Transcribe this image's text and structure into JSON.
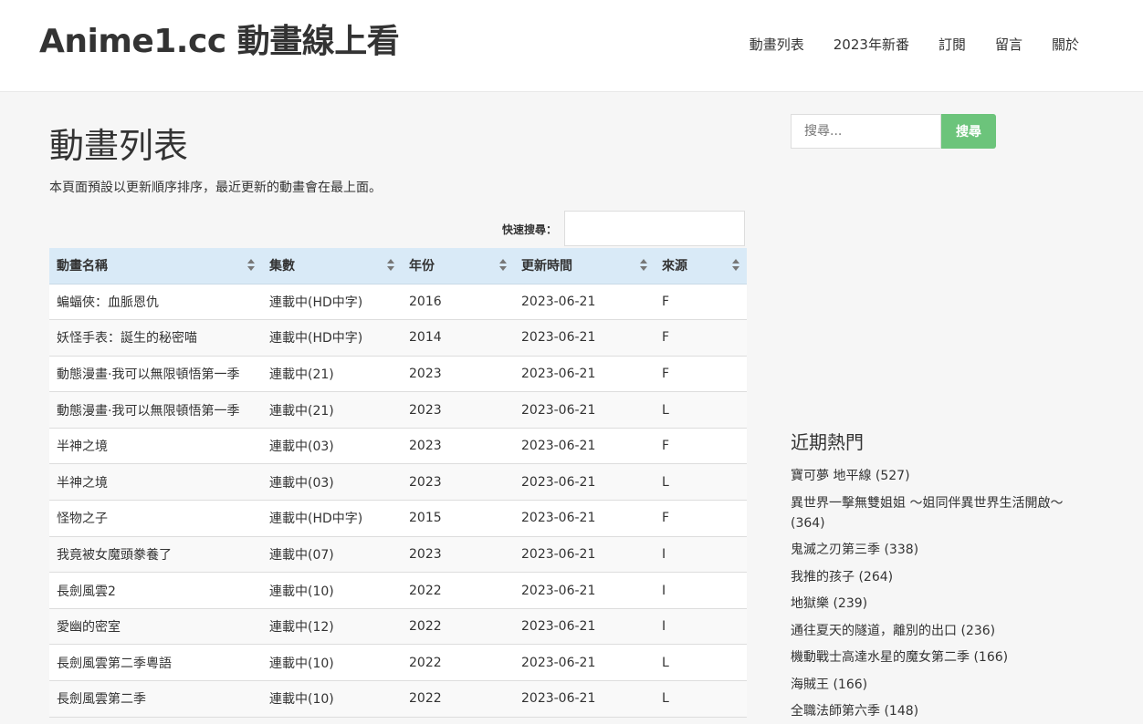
{
  "site": {
    "title": "Anime1.cc 動畫線上看"
  },
  "nav": [
    "動畫列表",
    "2023年新番",
    "訂閱",
    "留言",
    "關於"
  ],
  "page": {
    "title": "動畫列表",
    "intro": "本頁面預設以更新順序排序，最近更新的動畫會在最上面。",
    "quick_search_label": "快速搜尋："
  },
  "table": {
    "headers": [
      "動畫名稱",
      "集數",
      "年份",
      "更新時間",
      "來源"
    ],
    "rows": [
      [
        "蝙蝠俠：血脈恩仇",
        "連載中(HD中字)",
        "2016",
        "2023-06-21",
        "F"
      ],
      [
        "妖怪手表：誕生的秘密喵",
        "連載中(HD中字)",
        "2014",
        "2023-06-21",
        "F"
      ],
      [
        "動態漫畫·我可以無限頓悟第一季",
        "連載中(21)",
        "2023",
        "2023-06-21",
        "F"
      ],
      [
        "動態漫畫·我可以無限頓悟第一季",
        "連載中(21)",
        "2023",
        "2023-06-21",
        "L"
      ],
      [
        "半神之境",
        "連載中(03)",
        "2023",
        "2023-06-21",
        "F"
      ],
      [
        "半神之境",
        "連載中(03)",
        "2023",
        "2023-06-21",
        "L"
      ],
      [
        "怪物之子",
        "連載中(HD中字)",
        "2015",
        "2023-06-21",
        "F"
      ],
      [
        "我竟被女魔頭豢養了",
        "連載中(07)",
        "2023",
        "2023-06-21",
        "I"
      ],
      [
        "長劍風雲2",
        "連載中(10)",
        "2022",
        "2023-06-21",
        "I"
      ],
      [
        "愛幽的密室",
        "連載中(12)",
        "2022",
        "2023-06-21",
        "I"
      ],
      [
        "長劍風雲第二季粵語",
        "連載中(10)",
        "2022",
        "2023-06-21",
        "L"
      ],
      [
        "長劍風雲第二季",
        "連載中(10)",
        "2022",
        "2023-06-21",
        "L"
      ]
    ]
  },
  "sidebar": {
    "search_placeholder": "搜尋...",
    "search_button": "搜尋",
    "hot_title": "近期熱門",
    "hot_items": [
      "寶可夢 地平線 (527)",
      "異世界一擊無雙姐姐 ～姐同伴異世界生活開啟～ (364)",
      "鬼滅之刃第三季 (338)",
      "我推的孩子 (264)",
      "地獄樂 (239)",
      "通往夏天的隧道，離別的出口 (236)",
      "機動戰士高達水星的魔女第二季 (166)",
      "海賊王 (166)",
      "全職法師第六季 (148)"
    ]
  },
  "colors": {
    "accent": "#6cc47b",
    "table_header": "#d9eaf7"
  }
}
